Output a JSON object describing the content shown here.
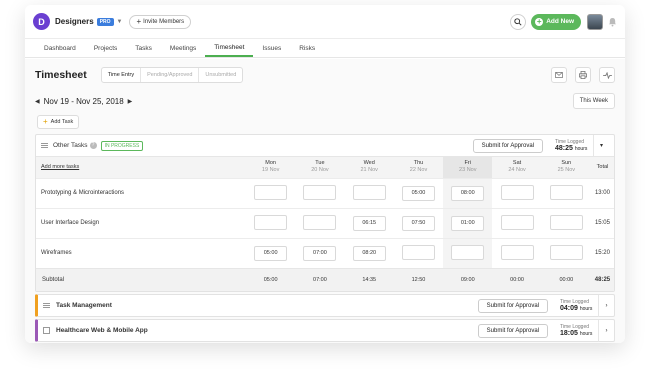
{
  "workspace": {
    "initial": "D",
    "name": "Designers",
    "badge": "PRO",
    "invite_label": "Invite Members"
  },
  "topbar": {
    "add_new_label": "Add New"
  },
  "nav": {
    "tabs": [
      "Dashboard",
      "Projects",
      "Tasks",
      "Meetings",
      "Timesheet",
      "Issues",
      "Risks"
    ],
    "active": "Timesheet"
  },
  "page": {
    "title": "Timesheet",
    "views": [
      "Time Entry",
      "Pending/Approved",
      "Unsubmitted"
    ],
    "active_view": "Time Entry"
  },
  "date": {
    "range": "Nov 19 - Nov 25, 2018",
    "this_week_label": "This Week",
    "add_task_label": "Add Task"
  },
  "group": {
    "title": "Other Tasks",
    "status": "IN PROGRESS",
    "submit_label": "Submit for Approval",
    "time_logged_label": "Time Logged",
    "time_logged_value": "48:25",
    "time_logged_unit": "hours",
    "add_more_label": "Add more tasks",
    "total_label": "Total",
    "days": [
      {
        "name": "Mon",
        "date": "19 Nov"
      },
      {
        "name": "Tue",
        "date": "20 Nov"
      },
      {
        "name": "Wed",
        "date": "21 Nov"
      },
      {
        "name": "Thu",
        "date": "22 Nov"
      },
      {
        "name": "Fri",
        "date": "23 Nov"
      },
      {
        "name": "Sat",
        "date": "24 Nov"
      },
      {
        "name": "Sun",
        "date": "25 Nov"
      }
    ],
    "rows": [
      {
        "name": "Prototyping & Microinteractions",
        "hours": [
          "",
          "",
          "",
          "05:00",
          "08:00",
          "",
          ""
        ],
        "total": "13:00"
      },
      {
        "name": "User Interface Design",
        "hours": [
          "",
          "",
          "06:15",
          "07:50",
          "01:00",
          "",
          ""
        ],
        "total": "15:05"
      },
      {
        "name": "Wireframes",
        "hours": [
          "05:00",
          "07:00",
          "08:20",
          "",
          "",
          "",
          ""
        ],
        "total": "15:20"
      }
    ],
    "subtotal": {
      "label": "Subtotal",
      "values": [
        "05:00",
        "07:00",
        "14:35",
        "12:50",
        "09:00",
        "00:00",
        "00:00"
      ],
      "total": "48:25"
    }
  },
  "projects": [
    {
      "name": "Task Management",
      "submit_label": "Submit for Approval",
      "time_logged_label": "Time Logged",
      "time_logged_value": "04:09",
      "time_logged_unit": "hours"
    },
    {
      "name": "Healthcare Web & Mobile App",
      "submit_label": "Submit for Approval",
      "time_logged_label": "Time Logged",
      "time_logged_value": "18:05",
      "time_logged_unit": "hours"
    }
  ],
  "colors": {
    "accent_green": "#5cb85c",
    "brand_purple": "#6a3fd1",
    "project_orange": "#f0a020",
    "project_purple": "#9b59b6"
  },
  "icons": [
    "search-icon",
    "bell-icon",
    "mail-icon",
    "print-icon",
    "activity-icon",
    "chevron-left-icon",
    "chevron-right-icon",
    "chevron-down-icon",
    "help-icon",
    "list-icon",
    "flag-icon"
  ]
}
